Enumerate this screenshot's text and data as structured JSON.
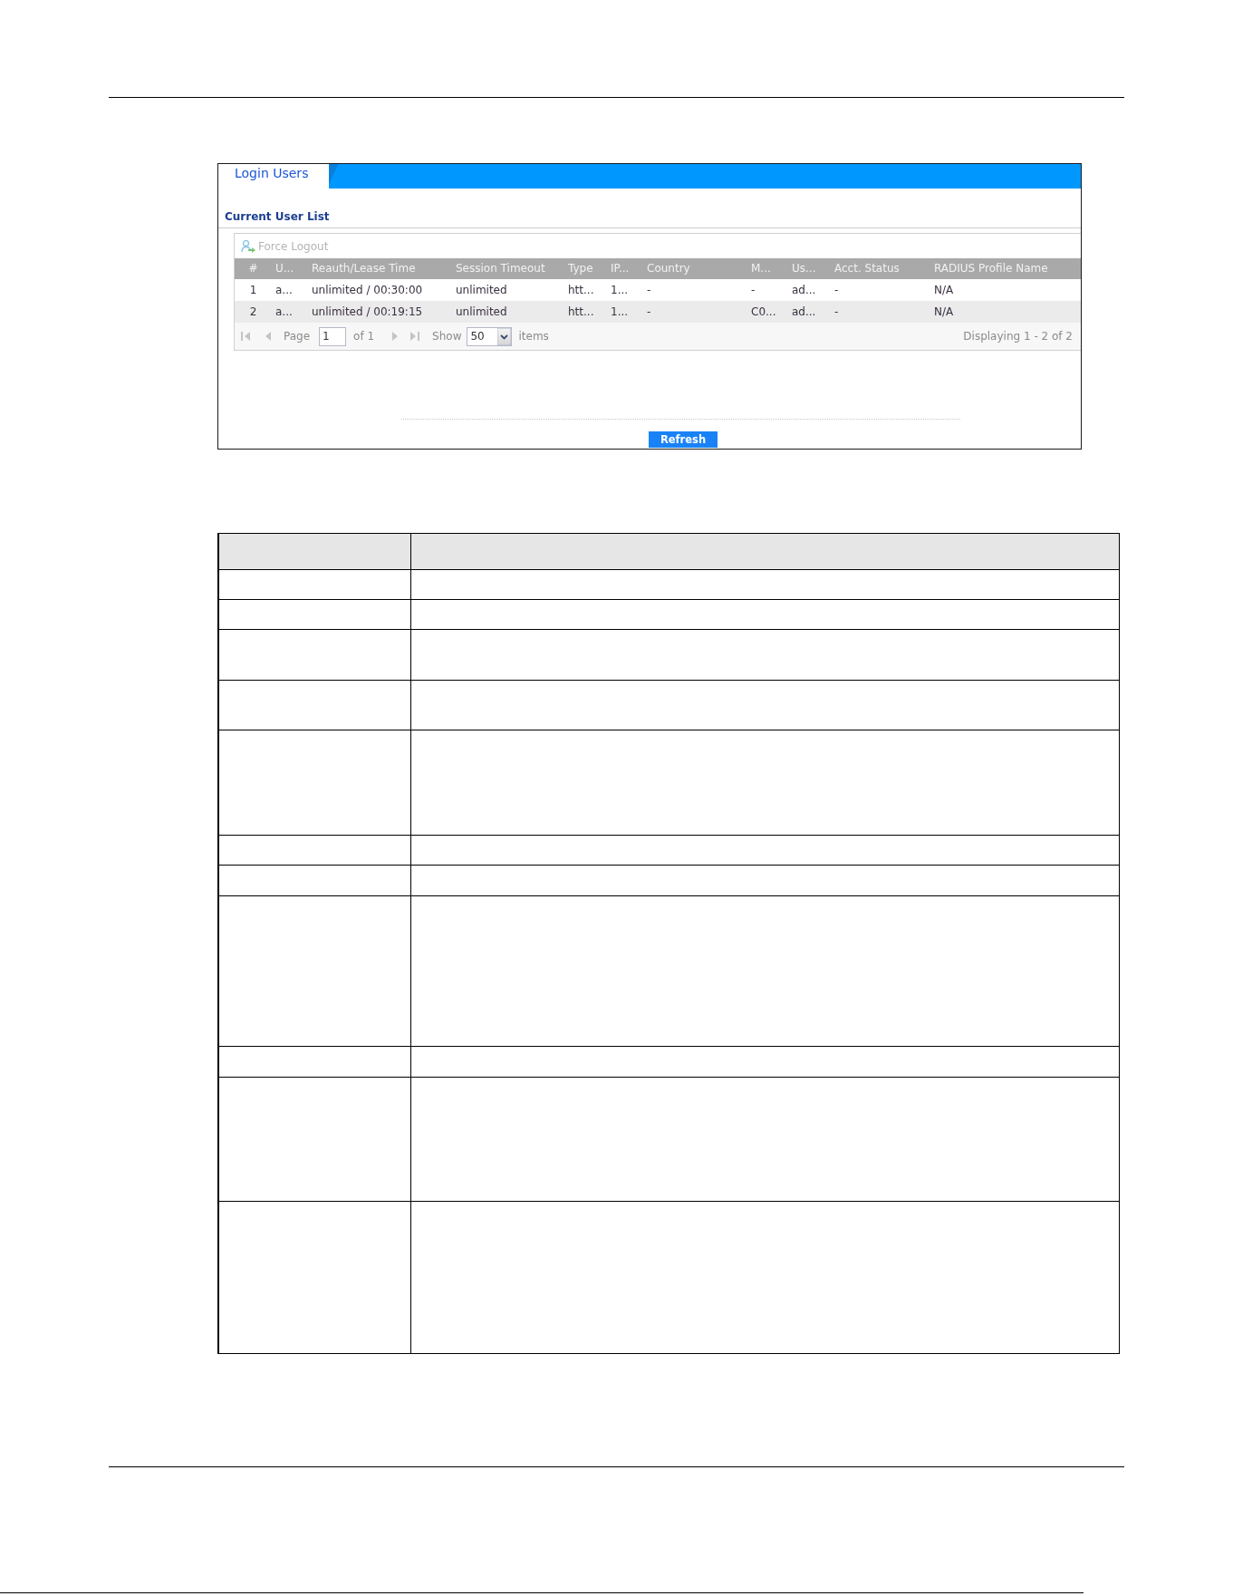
{
  "tabs": [
    {
      "label": "Login Users",
      "selected": true
    }
  ],
  "section_title": "Current User List",
  "toolbar": {
    "force_logout": {
      "label": "Force Logout",
      "disabled": true
    }
  },
  "user_table": {
    "columns": [
      "#",
      "U...",
      "Reauth/Lease Time",
      "Session Timeout",
      "Type",
      "IP...",
      "Country",
      "M...",
      "Us...",
      "Acct. Status",
      "RADIUS Profile Name"
    ],
    "rows": [
      {
        "cells": [
          "1",
          "a...",
          "unlimited / 00:30:00",
          "unlimited",
          "htt...",
          "1...",
          "-",
          "-",
          "ad...",
          "-",
          "N/A"
        ]
      },
      {
        "cells": [
          "2",
          "a...",
          "unlimited / 00:19:15",
          "unlimited",
          "htt...",
          "1...",
          "-",
          "C0...",
          "ad...",
          "-",
          "N/A"
        ]
      }
    ]
  },
  "pager": {
    "back_buttons": [
      {
        "kind": "first",
        "disabled": true
      },
      {
        "kind": "prev",
        "disabled": true
      }
    ],
    "page_label": "Page",
    "page_value": "1",
    "page_count": "of 1",
    "forward_buttons": [
      {
        "kind": "next",
        "disabled": true
      },
      {
        "kind": "last",
        "disabled": true
      }
    ],
    "show_label": "Show",
    "per_page": "50",
    "items_label": "items",
    "summary": "Displaying 1 - 2 of 2"
  },
  "refresh_button": {
    "label": "Refresh"
  }
}
